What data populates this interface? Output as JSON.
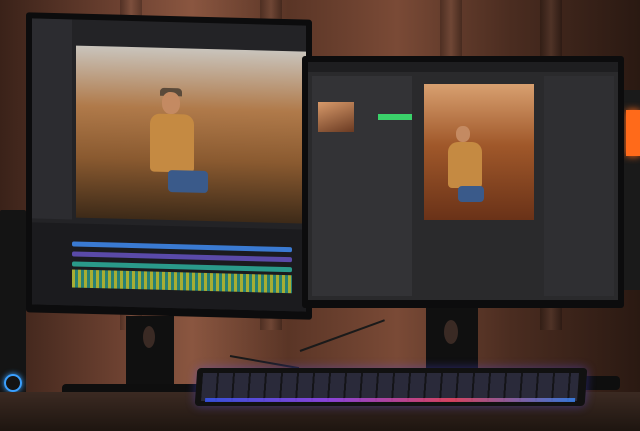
{
  "scene": {
    "description_tags": [
      "dual-monitor-setup",
      "video-editor",
      "photo-editor",
      "rgb-keyboard"
    ],
    "colors": {
      "wall_warm": "#7a4a36",
      "screen_dark": "#232326",
      "accent_green": "#3ad26a",
      "timeline_teal": "#2a9a8a",
      "keyboard_glow": "#3a5aff",
      "speaker_led": "#3aa0ff",
      "device_led": "#ff6a1a"
    }
  }
}
